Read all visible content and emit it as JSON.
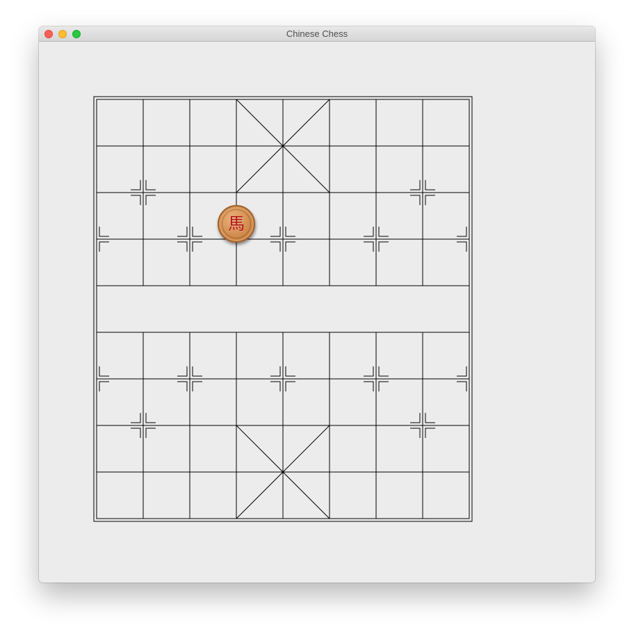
{
  "window": {
    "title": "Chinese Chess"
  },
  "board": {
    "files": 9,
    "ranks": 10,
    "river_text": ""
  },
  "pieces": [
    {
      "glyph": "馬",
      "name": "horse",
      "side": "red",
      "file": 3,
      "rank": 3
    }
  ],
  "colors": {
    "window_bg": "#ececec",
    "line": "#000000",
    "piece_text": "#b0141a",
    "piece_face": "#d18b4c"
  }
}
